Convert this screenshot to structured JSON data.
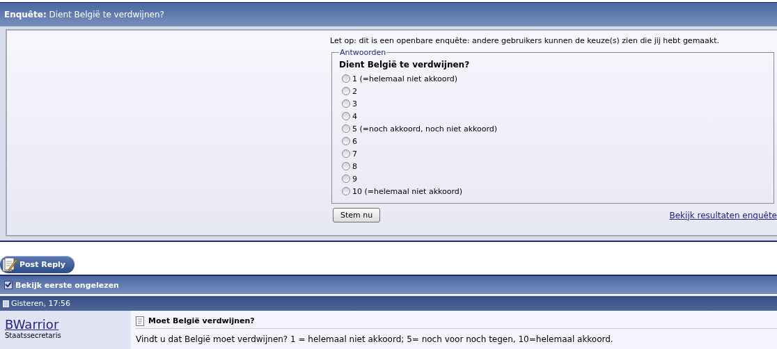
{
  "poll": {
    "title_label": "Enquête:",
    "title": "Dient België te verdwijnen?",
    "notice": "Let op: dit is een openbare enquête: andere gebruikers kunnen de keuze(s) zien die jij hebt gemaakt.",
    "legend": "Antwoorden",
    "question": "Dient België te verdwijnen?",
    "options": [
      {
        "label": "1 (=helemaal niet akkoord)",
        "selected": false
      },
      {
        "label": "2",
        "selected": false
      },
      {
        "label": "3",
        "selected": false
      },
      {
        "label": "4",
        "selected": false
      },
      {
        "label": "5 (=noch akkoord, noch niet akkoord)",
        "selected": false
      },
      {
        "label": "6",
        "selected": false
      },
      {
        "label": "7",
        "selected": false
      },
      {
        "label": "8",
        "selected": false
      },
      {
        "label": "9",
        "selected": false
      },
      {
        "label": "10 (=helemaal niet akkoord)",
        "selected": false
      }
    ],
    "vote_button": "Stem nu",
    "results_link": "Bekijk resultaten enquête"
  },
  "post_reply_button": "Post Reply",
  "unread_bar": "Bekijk eerste ongelezen",
  "post": {
    "date": "Gisteren, 17:56",
    "author": "BWarrior",
    "rank": "Staatssecretaris",
    "title": "Moet België verdwijnen?",
    "body": "Vindt u dat België moet verdwijnen? 1 = helemaal niet akkoord; 5= noch voor noch tegen, 10=helemaal akkoord."
  }
}
